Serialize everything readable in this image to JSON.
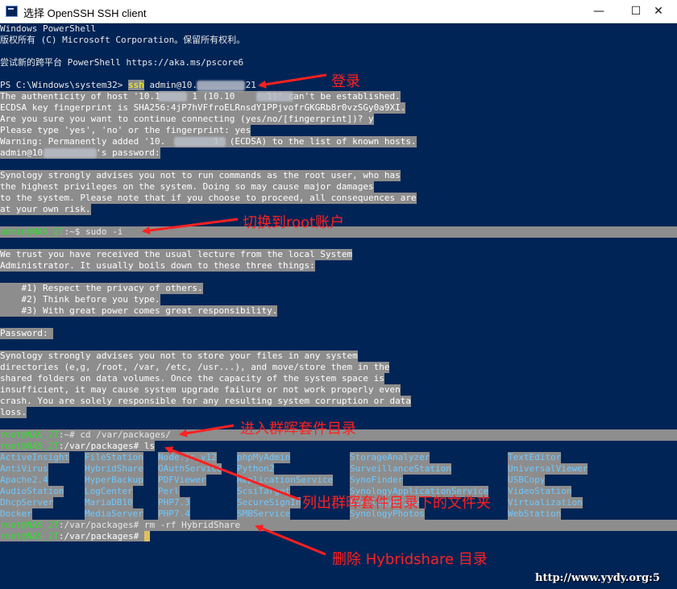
{
  "window": {
    "title": "选择 OpenSSH SSH client",
    "min_glyph": "—",
    "max_glyph": "☐",
    "close_glyph": "✕"
  },
  "console": {
    "lines": [
      {
        "text": "Windows PowerShell",
        "y": 0
      },
      {
        "text": "版权所有 (C) Microsoft Corporation。保留所有权利。",
        "y": 14
      },
      {
        "text": "尝试新的跨平台 PowerShell https://aka.ms/pscore6",
        "y": 42
      }
    ],
    "ssh_prompt": "PS C:\\Windows\\system32> ",
    "ssh_cmd": "ssh",
    "ssh_rest": " admin@10.         21",
    "auth_lines": [
      "The authenticity of host '10.1      1 (10.10      1)' can't be established.",
      "ECDSA key fingerprint is SHA256:4jP7hVFfroELRnsdY1PPjvofrGKGRb8r0vzSGy0a9XI.",
      "Are you sure you want to continue connecting (yes/no/[fingerprint])? y",
      "Please type 'yes', 'no' or the fingerprint: yes",
      "Warning: Permanently added '10.         1' (ECDSA) to the list of known hosts.",
      "admin@10          's password:"
    ],
    "warn1_lines": [
      "Synology strongly advises you not to run commands as the root user, who has",
      "the highest privileges on the system. Doing so may cause major damages",
      "to the system. Please note that if you choose to proceed, all consequences are",
      "at your own risk."
    ],
    "sudo_user": "admin@NAS_2T",
    "sudo_path": ":~$ sudo -i",
    "lecture_lines": [
      "We trust you have received the usual lecture from the local System",
      "Administrator. It usually boils down to these three things:"
    ],
    "rules_lines": [
      "    #1) Respect the privacy of others.",
      "    #2) Think before you type.",
      "    #3) With great power comes great responsibility."
    ],
    "password_line": "Password: ",
    "warn2_lines": [
      "Synology strongly advises you not to store your files in any system",
      "directories (e,g, /root, /var, /etc, /usr...), and move/store them in the",
      "shared folders on data volumes. Once the capacity of the system space is",
      "insufficient, it may cause system upgrade failure or not work properly even",
      "crash. You are solely responsible for any resulting system corruption or data",
      "loss."
    ],
    "cd_user": "root@NAS_2T",
    "cd_cmd": ":~# cd /var/packages/",
    "ls_user": "root@NAS_2T",
    "ls_cmd": ":/var/packages# ls",
    "listing": [
      [
        "ActiveInsight",
        "FileStation",
        "Node.js_v12",
        "phpMyAdmin",
        "StorageAnalyzer",
        "TextEditor"
      ],
      [
        "AntiVirus",
        "HybridShare",
        "OAuthService",
        "Python2",
        "SurveillanceStation",
        "UniversalViewer"
      ],
      [
        "Apache2.4",
        "HyperBackup",
        "PDFViewer",
        "ReplicationService",
        "SynoFinder",
        "USBCopy"
      ],
      [
        "AudioStation",
        "LogCenter",
        "Perl",
        "ScsiTarget",
        "SynologyApplicationService",
        "VideoStation"
      ],
      [
        "DhcpServer",
        "MariaDB10",
        "PHP7.3",
        "SecureSignIn",
        "SynologyDrive",
        "Virtualization"
      ],
      [
        "Docker",
        "MediaServer",
        "PHP7.4",
        "SMBService",
        "SynologyPhotos",
        "WebStation"
      ]
    ],
    "rm_user": "root@NAS_2T",
    "rm_cmd": ":/var/packages# rm -rf HybridShare",
    "final_user": "root@NAS_2T",
    "final_cmd": ":/var/packages# "
  },
  "annotations": {
    "login": "登录",
    "switch_root": "切换到root账户",
    "enter_dir": "进入群晖套件目录",
    "list_files": "列出群晖套件目录下的文件夹",
    "delete_dir": "删除 Hybridshare 目录"
  },
  "watermark": "http://www.yydy.org:5",
  "colors": {
    "console_bg": "#012456",
    "highlight_bg": "#8d8d8d",
    "prompt_green": "#2de02d",
    "annotation_red": "#ff2020",
    "ls_dir_blue": "#6ec8ff"
  }
}
